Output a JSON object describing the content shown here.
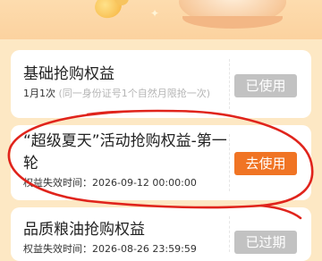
{
  "cards": [
    {
      "title": "基础抢购权益",
      "sub_main": "1月1次",
      "sub_muted": "(同一身份证号1个自然月限抢一次)",
      "button_label": "已使用",
      "status": "used"
    },
    {
      "title_line1": "“超级夏天”活动抢购权益-第一",
      "title_line2": "轮",
      "sub_main": "权益失效时间：2026-09-12 00:00:00",
      "button_label": "去使用",
      "status": "available"
    },
    {
      "title": "品质粮油抢购权益",
      "sub_main": "权益失效时间：2026-08-26 23:59:59",
      "button_label": "已过期",
      "status": "expired"
    }
  ],
  "colors": {
    "background": "#fde8c4",
    "primary_button": "#f07424",
    "disabled_button": "#c2c2c2",
    "annotation_circle": "#e0241c"
  }
}
